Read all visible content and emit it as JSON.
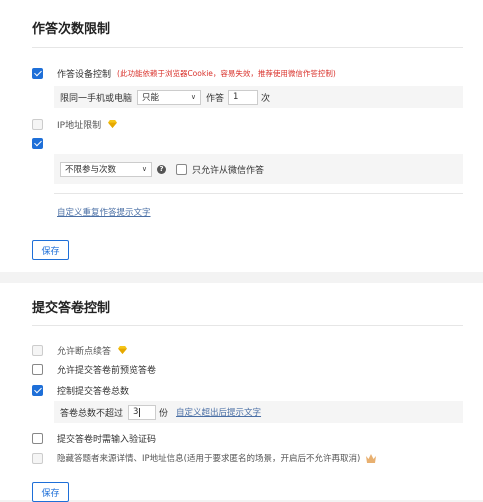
{
  "section1": {
    "title": "作答次数限制",
    "device_control": {
      "label": "作答设备控制",
      "note": "(此功能依赖于浏览器Cookie，容易失效，推荐使用微信作答控制)",
      "checked": true,
      "limit_label": "限同一手机或电脑",
      "limit_select": "只能",
      "answer_label": "作答",
      "answer_count": "1",
      "count_unit": "次"
    },
    "ip_limit": {
      "label": "IP地址限制",
      "checked": false,
      "disabled": true
    },
    "third": {
      "checked": true,
      "participation_select": "不限参与次数",
      "wechat_only_label": "只允许从微信作答",
      "wechat_only_checked": false
    },
    "custom_repeat_link": "自定义重复作答提示文字",
    "save_label": "保存"
  },
  "section2": {
    "title": "提交答卷控制",
    "items": [
      {
        "label": "允许断点续答",
        "checked": false,
        "disabled": true
      },
      {
        "label": "允许提交答卷前预览答卷",
        "checked": false,
        "disabled": false
      },
      {
        "label": "控制提交答卷总数",
        "checked": true,
        "disabled": false
      }
    ],
    "total_limit": {
      "label": "答卷总数不超过",
      "value": "3",
      "unit": "份",
      "link": "自定义超出后提示文字"
    },
    "captcha": {
      "label": "提交答卷时需输入验证码",
      "checked": false
    },
    "hide_info": {
      "label": "隐藏答题者来源详情、IP地址信息(适用于要求匿名的场景，开启后不允许再取消)",
      "checked": false,
      "disabled": true
    },
    "save_label": "保存"
  },
  "colors": {
    "accent": "#1e6fd8",
    "warning_text": "#d9302a",
    "diamond": "#f5c518",
    "link": "#4a6fa5"
  }
}
